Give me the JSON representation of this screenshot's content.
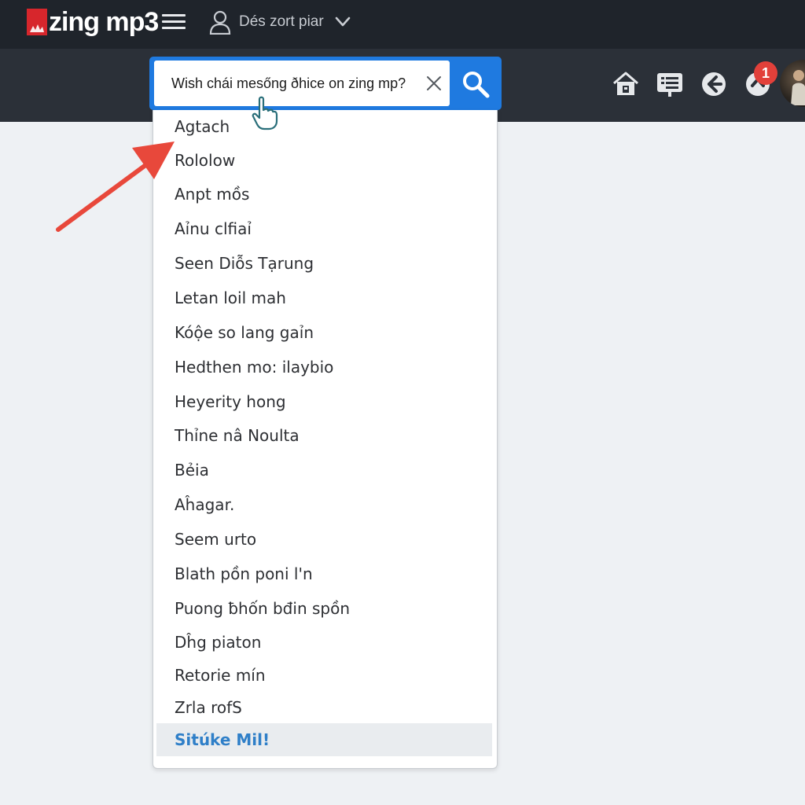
{
  "app": {
    "name": "zing mp3",
    "brand_color": "#d7262c"
  },
  "header": {
    "user_name": "Dés zort piar",
    "hamburger_icon": "menu-icon",
    "user_icon": "user-icon",
    "chevron_icon": "chevron-down-icon"
  },
  "search": {
    "value": "Wish chái mesőng ðhice on zing mp?",
    "clear_icon": "close-icon",
    "submit_icon": "search-icon",
    "accent": "#1f7ae0"
  },
  "nav": {
    "icons": [
      "home-icon",
      "playlist-icon",
      "back-icon",
      "notification-icon"
    ],
    "notification_count": "1"
  },
  "suggestions": [
    "Agtach",
    "Rololow",
    "Anpt mồs",
    "Aỉnu clfiaỉ",
    "Seen Diỗs Tạrung",
    "Letan loil mah",
    "Kóộe so lang gaỉn",
    "Hedthen mo: ilaybiо",
    "Heyerity hong",
    "Thỉne nâ Noulta",
    "Bẻia",
    "Aĥagar.",
    "Seem urto",
    "Blath pồn poni l'n",
    "Puong ƀhốn bđin spồn",
    "Dĥg piaton",
    "Retorie mín",
    "Zrla rofS",
    "Sitúke Mil!"
  ],
  "selected_suggestion_index": 18,
  "highlight_color": "#2f7fc8"
}
